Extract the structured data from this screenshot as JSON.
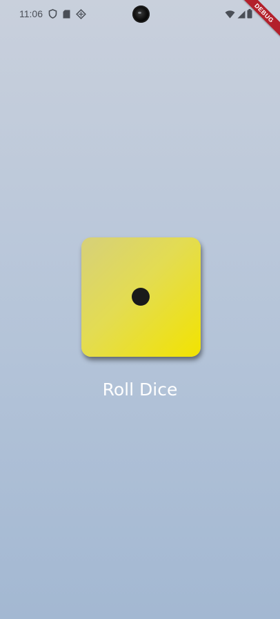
{
  "status_bar": {
    "time": "11:06",
    "icons_left": [
      "shield-icon",
      "sd-card-icon",
      "vpn-icon"
    ],
    "icons_right": [
      "wifi-icon",
      "signal-icon",
      "battery-icon"
    ]
  },
  "debug_banner": {
    "label": "DEBUG",
    "color": "#b3202b"
  },
  "dice": {
    "face_value": 1,
    "color_start": "#d6d07a",
    "color_end": "#f2e300",
    "pip_color": "#1a1a1a"
  },
  "roll_button": {
    "label": "Roll Dice"
  }
}
